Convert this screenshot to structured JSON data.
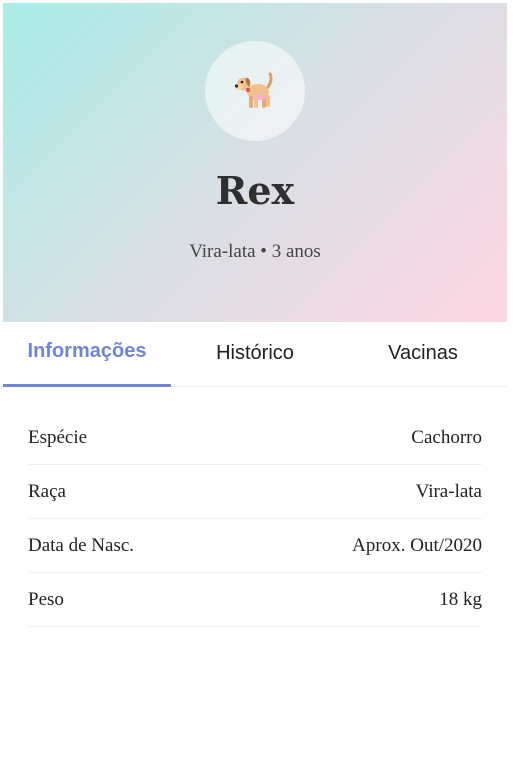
{
  "pet": {
    "name": "Rex",
    "subtitle": "Vira-lata • 3 anos",
    "avatar_icon": "dog-icon"
  },
  "colors": {
    "accent": "#6f86d6",
    "gradient_start": "#a8ede6",
    "gradient_end": "#fed6e3"
  },
  "tabs": [
    {
      "label": "Informações",
      "active": true
    },
    {
      "label": "Histórico",
      "active": false
    },
    {
      "label": "Vacinas",
      "active": false
    }
  ],
  "info": [
    {
      "label": "Espécie",
      "value": "Cachorro"
    },
    {
      "label": "Raça",
      "value": "Vira-lata"
    },
    {
      "label": "Data de Nasc.",
      "value": "Aprox. Out/2020"
    },
    {
      "label": "Peso",
      "value": "18 kg"
    }
  ]
}
